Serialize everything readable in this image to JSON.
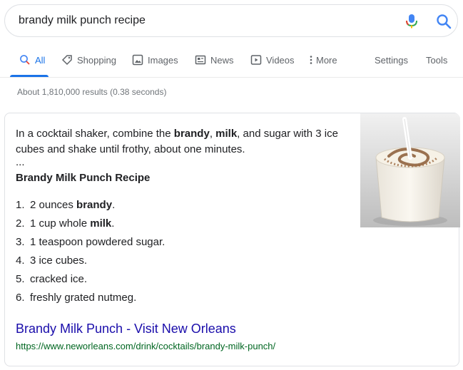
{
  "search": {
    "query": "brandy milk punch recipe"
  },
  "tabs": [
    {
      "label": "All",
      "icon": "search-icon"
    },
    {
      "label": "Shopping",
      "icon": "tag-icon"
    },
    {
      "label": "Images",
      "icon": "image-icon"
    },
    {
      "label": "News",
      "icon": "news-icon"
    },
    {
      "label": "Videos",
      "icon": "play-icon"
    },
    {
      "label": "More",
      "icon": "kebab-icon"
    },
    {
      "label": "Settings"
    },
    {
      "label": "Tools"
    }
  ],
  "stats": "About 1,810,000 results (0.38 seconds)",
  "snippet": {
    "lead": {
      "p1": "In a cocktail shaker, combine the ",
      "b1": "brandy",
      "p2": ", ",
      "b2": "milk",
      "p3": ", and sugar with 3 ice cubes and shake until frothy, about one minutes."
    },
    "ellipsis": "...",
    "title": "Brandy Milk Punch Recipe",
    "steps": [
      {
        "num": "1.",
        "text": "2 ounces ",
        "bold": "brandy",
        "after": "."
      },
      {
        "num": "2.",
        "text": "1 cup whole ",
        "bold": "milk",
        "after": "."
      },
      {
        "num": "3.",
        "text": "1 teaspoon powdered sugar.",
        "bold": "",
        "after": ""
      },
      {
        "num": "4.",
        "text": "3 ice cubes.",
        "bold": "",
        "after": ""
      },
      {
        "num": "5.",
        "text": "cracked ice.",
        "bold": "",
        "after": ""
      },
      {
        "num": "6.",
        "text": "freshly grated nutmeg.",
        "bold": "",
        "after": ""
      }
    ],
    "link_title": "Brandy Milk Punch - Visit New Orleans",
    "link_url": "https://www.neworleans.com/drink/cocktails/brandy-milk-punch/"
  },
  "colors": {
    "accent": "#1a73e8",
    "link": "#1a0dab",
    "url_green": "#006621",
    "muted": "#70757a"
  }
}
